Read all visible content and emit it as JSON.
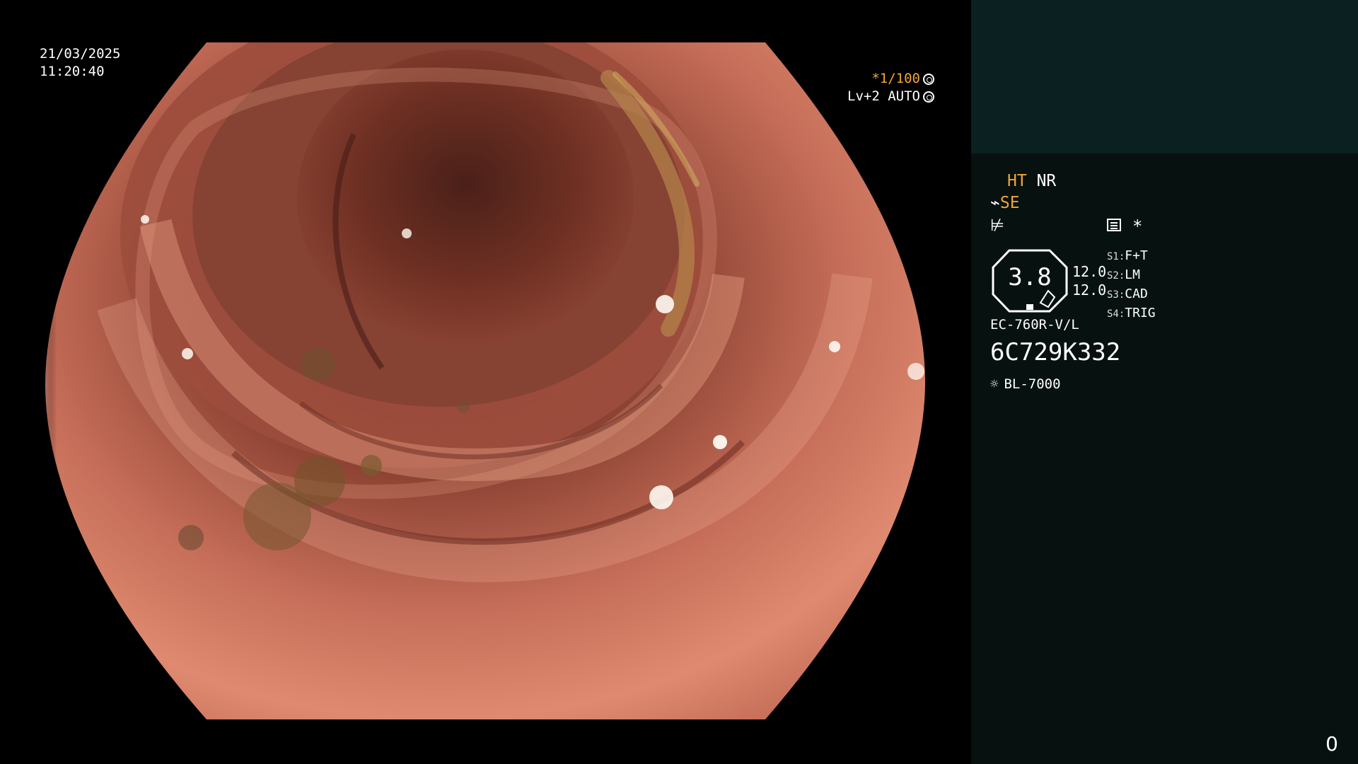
{
  "video": {
    "date": "21/03/2025",
    "time": "11:20:40",
    "shutter": "*1/100",
    "shutter_icon": "aperture-icon",
    "level": "Lv+2 AUTO",
    "level_icon": "auto-iris-icon"
  },
  "panel": {
    "ht": "HT",
    "nr": "NR",
    "se_icon": "scope-icon",
    "se": "SE",
    "f_icon": "freeze-off-icon",
    "menu_icon": "settings-list-icon",
    "star": "*",
    "zoom": "3.8",
    "val1": "12.0",
    "val2": "12.0",
    "shortcuts": [
      {
        "key": "S1:",
        "label": "F+T"
      },
      {
        "key": "S2:",
        "label": "LM"
      },
      {
        "key": "S3:",
        "label": "CAD"
      },
      {
        "key": "S4:",
        "label": "TRIG"
      }
    ],
    "model": "EC-760R-V/L",
    "serial": "6C729K332",
    "light_icon": "light-source-icon",
    "light_source": "BL-7000",
    "page_number": "0"
  },
  "colors": {
    "accent": "#f2a534",
    "panel_bg": "#071110",
    "panel_header": "#0b2020",
    "tissue": "#d17e67",
    "lumen": "#3b1b16"
  }
}
